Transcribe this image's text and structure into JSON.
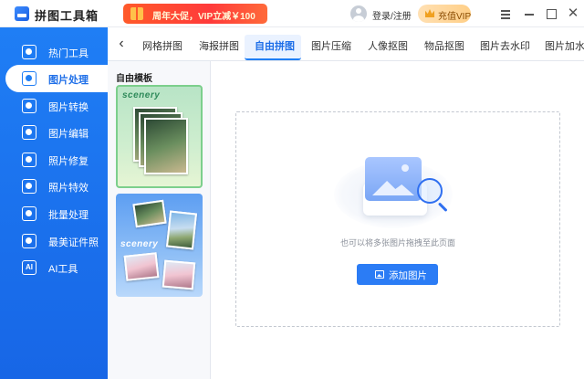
{
  "app": {
    "title": "拼图工具箱",
    "promo": "周年大促，VIP立减￥100",
    "login": "登录/注册",
    "vip": "充值VIP"
  },
  "sidebar": {
    "items": [
      {
        "label": "热门工具",
        "icon": "hot-tools-icon"
      },
      {
        "label": "图片处理",
        "icon": "image-process-icon",
        "active": true
      },
      {
        "label": "图片转换",
        "icon": "image-convert-icon"
      },
      {
        "label": "图片编辑",
        "icon": "image-edit-icon"
      },
      {
        "label": "照片修复",
        "icon": "photo-repair-icon"
      },
      {
        "label": "照片特效",
        "icon": "photo-effects-icon"
      },
      {
        "label": "批量处理",
        "icon": "batch-process-icon"
      },
      {
        "label": "最美证件照",
        "icon": "id-photo-icon"
      },
      {
        "label": "AI工具",
        "icon": "ai-icon",
        "icon_text": "AI"
      }
    ]
  },
  "tabs": {
    "items": [
      "网格拼图",
      "海报拼图",
      "自由拼图",
      "图片压缩",
      "人像抠图",
      "物品抠图",
      "图片去水印",
      "图片加水"
    ],
    "active": "自由拼图"
  },
  "templates": {
    "title": "自由模板",
    "card_text": "scenery"
  },
  "main": {
    "hint": "也可以将多张图片拖拽至此页面",
    "add_button": "添加图片"
  },
  "colors": {
    "accent": "#1f7ef5",
    "sidebar": "#1766e6",
    "promo": "#ff3a3a",
    "vip": "#ffcf87"
  }
}
